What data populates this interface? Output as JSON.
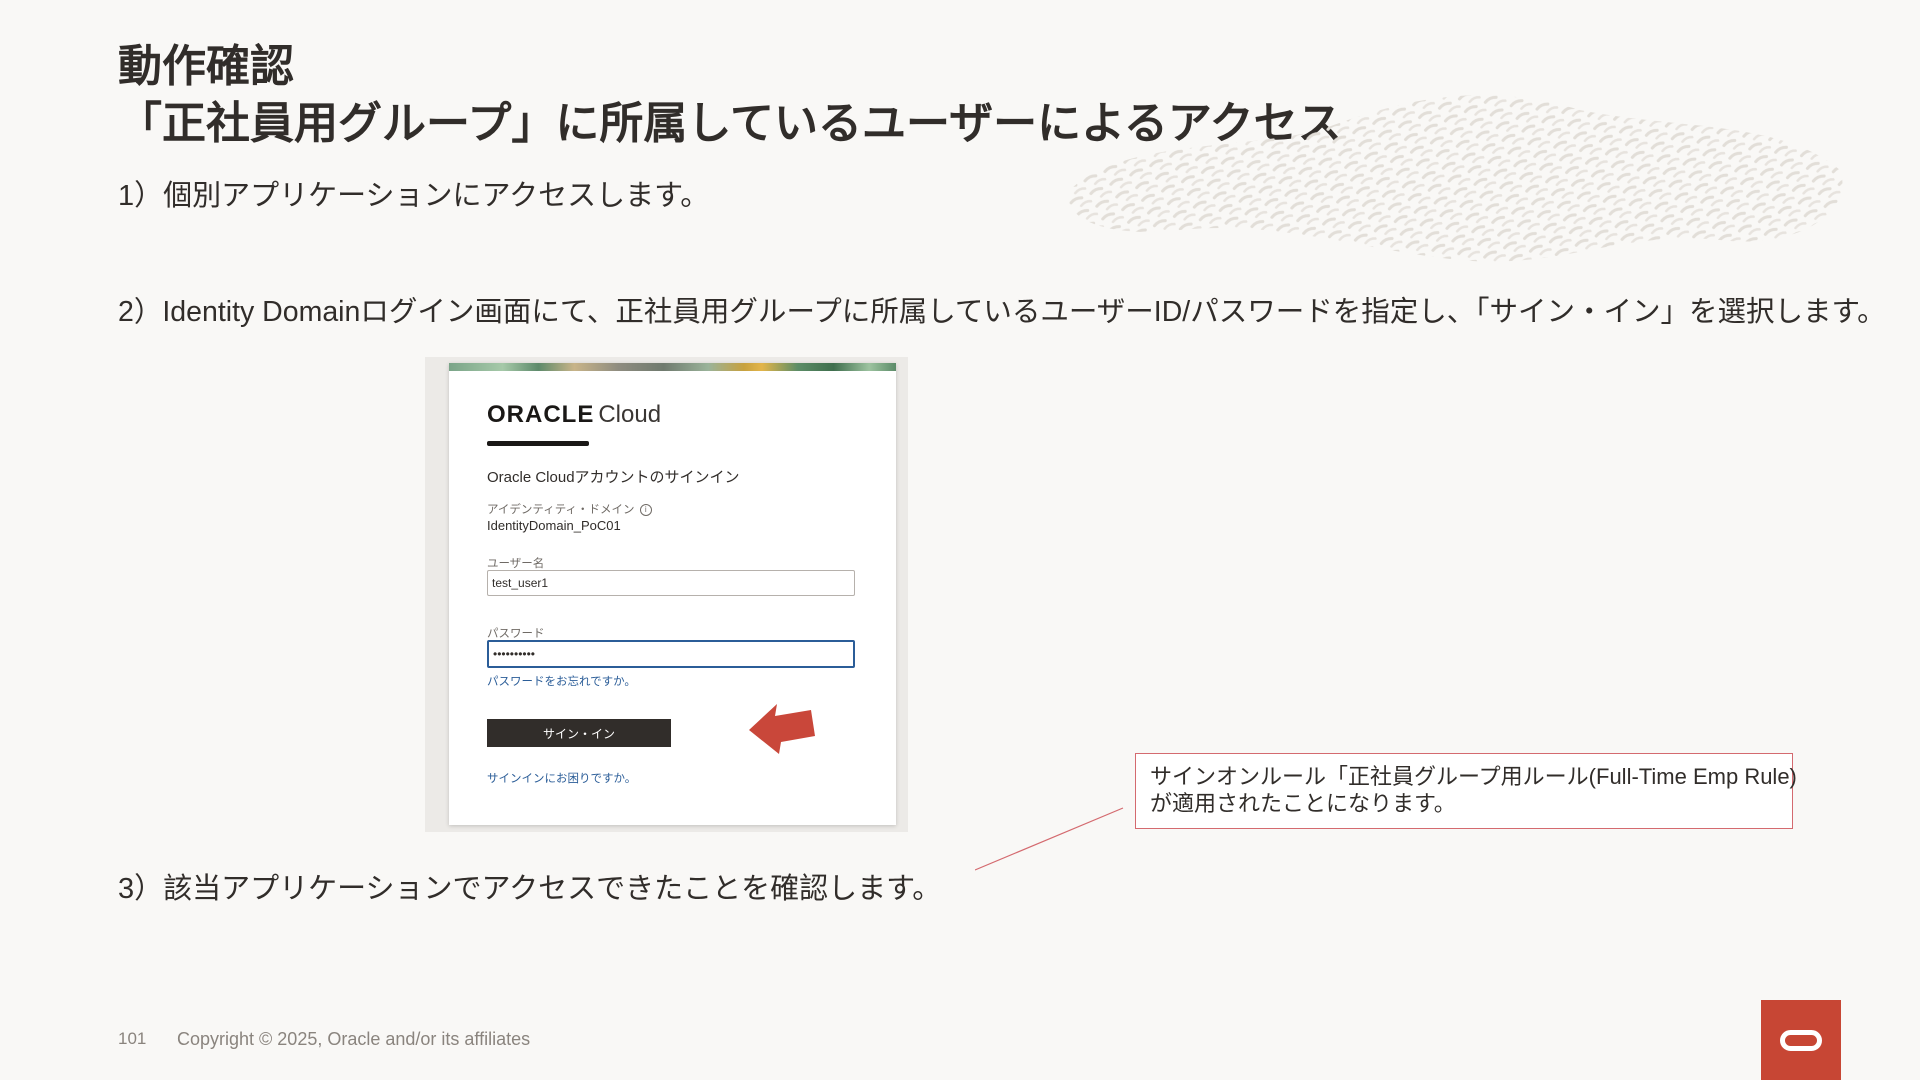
{
  "title": {
    "line1": "動作確認",
    "line2": "「正社員用グループ」に所属しているユーザーによるアクセス"
  },
  "steps": {
    "step1": "1）個別アプリケーションにアクセスします。",
    "step2": "2）Identity Domainログイン画面にて、正社員用グループに所属しているユーザーID/パスワードを指定し、「サイン・イン」を選択します。",
    "step3": "3）該当アプリケーションでアクセスできたことを確認します。"
  },
  "login": {
    "brand": "ORACLE",
    "brand_suffix": "Cloud",
    "heading": "Oracle Cloudアカウントのサインイン",
    "domain_label": "アイデンティティ・ドメイン",
    "info_icon": "i",
    "domain_value": "IdentityDomain_PoC01",
    "username_label": "ユーザー名",
    "username_value": "test_user1",
    "password_label": "パスワード",
    "password_value": "••••••••••",
    "forgot_link": "パスワードをお忘れですか。",
    "signin_button": "サイン・イン",
    "help_link": "サインインにお困りですか。"
  },
  "callout": {
    "line1": "サインオンルール「正社員グループ用ルール(Full-Time Emp Rule)",
    "line2": "が適用されたことになります。"
  },
  "footer": {
    "page_number": "101",
    "copyright": "Copyright © 2025, Oracle and/or its affiliates"
  },
  "colors": {
    "accent_red": "#c74634",
    "callout_border": "#d46a6f",
    "arrow": "#c9473a",
    "link_blue": "#2b5d98",
    "text_dark": "#312d2a"
  }
}
